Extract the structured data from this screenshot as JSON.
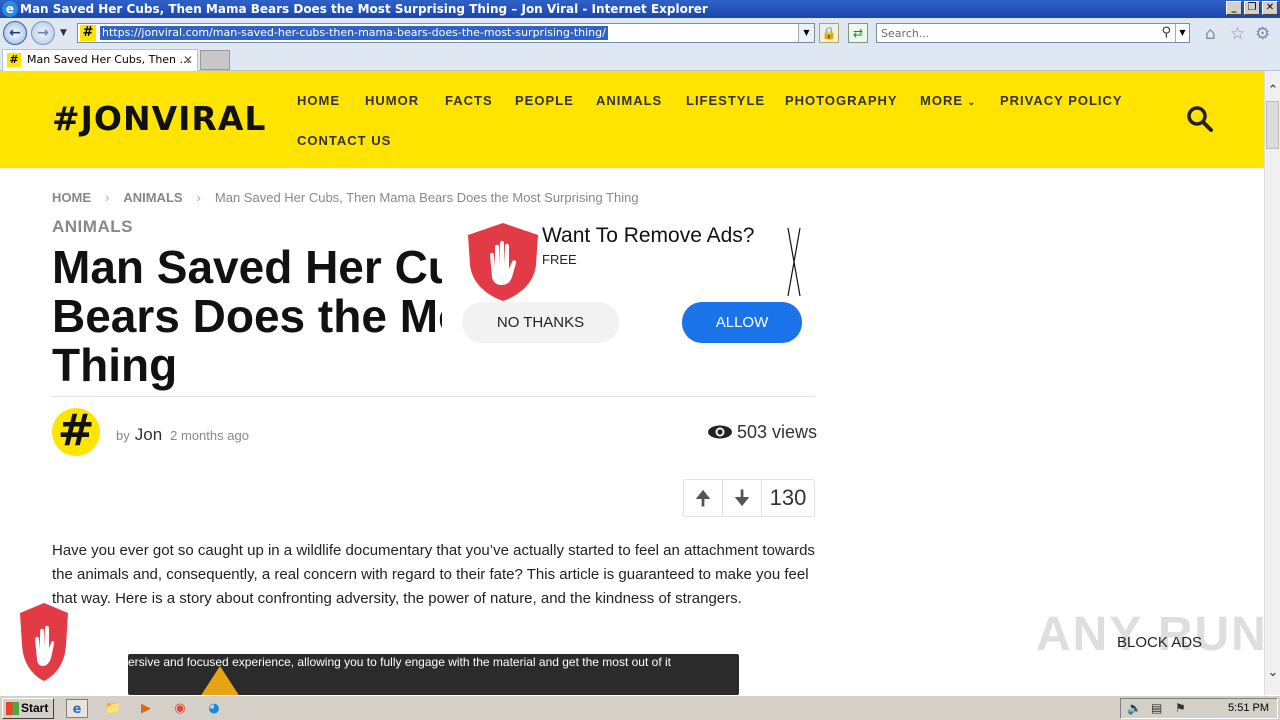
{
  "window": {
    "title": "Man Saved Her Cubs, Then Mama Bears Does the Most Surprising Thing – Jon Viral - Internet Explorer",
    "controls": [
      "_",
      "❐",
      "✕"
    ]
  },
  "address_bar": {
    "url": "https://jonviral.com/man-saved-her-cubs-then-mama-bears-does-the-most-surprising-thing/",
    "search_placeholder": "Search..."
  },
  "tabs": [
    {
      "label": "Man Saved Her Cubs, Then ...",
      "active": true
    }
  ],
  "site": {
    "logo": "#JONVIRAL",
    "brand_color": "#ffe400",
    "menu": [
      {
        "label": "HOME"
      },
      {
        "label": "HUMOR"
      },
      {
        "label": "FACTS"
      },
      {
        "label": "PEOPLE"
      },
      {
        "label": "ANIMALS"
      },
      {
        "label": "LIFESTYLE"
      },
      {
        "label": "PHOTOGRAPHY"
      },
      {
        "label": "MORE"
      },
      {
        "label": "PRIVACY POLICY"
      },
      {
        "label": "CONTACT US"
      }
    ]
  },
  "breadcrumb": {
    "home": "HOME",
    "category": "ANIMALS",
    "current": "Man Saved Her Cubs, Then Mama Bears Does the Most Surprising Thing"
  },
  "article": {
    "category": "ANIMALS",
    "title": "Man Saved Her Cubs, Then Mama Bears Does the Most Surprising Thing",
    "by": "by",
    "author": "Jon",
    "avatar_glyph": "#",
    "date": "2 months ago",
    "views": "503 views",
    "vote_count": "130",
    "body": "Have you ever got so caught up in a wildlife documentary that you’ve actually started to feel an attachment towards the animals and, consequently, a real concern with regard to their fate? This article is guaranteed to make you feel that way. Here is a story about confronting adversity, the power of nature, and the kindness of strangers.",
    "video_caption": "ersive and focused experience, allowing you to fully engage with the material and get the most out of it"
  },
  "ad_popup": {
    "title": "Want To Remove Ads?",
    "subtitle": "FREE",
    "decline": "NO THANKS",
    "accept": "ALLOW",
    "accept_color": "#1a73e8"
  },
  "overlay": {
    "watermark": "ANY RUN",
    "block_ads": "BLOCK ADS"
  },
  "taskbar": {
    "start": "Start",
    "clock": "5:51 PM"
  }
}
